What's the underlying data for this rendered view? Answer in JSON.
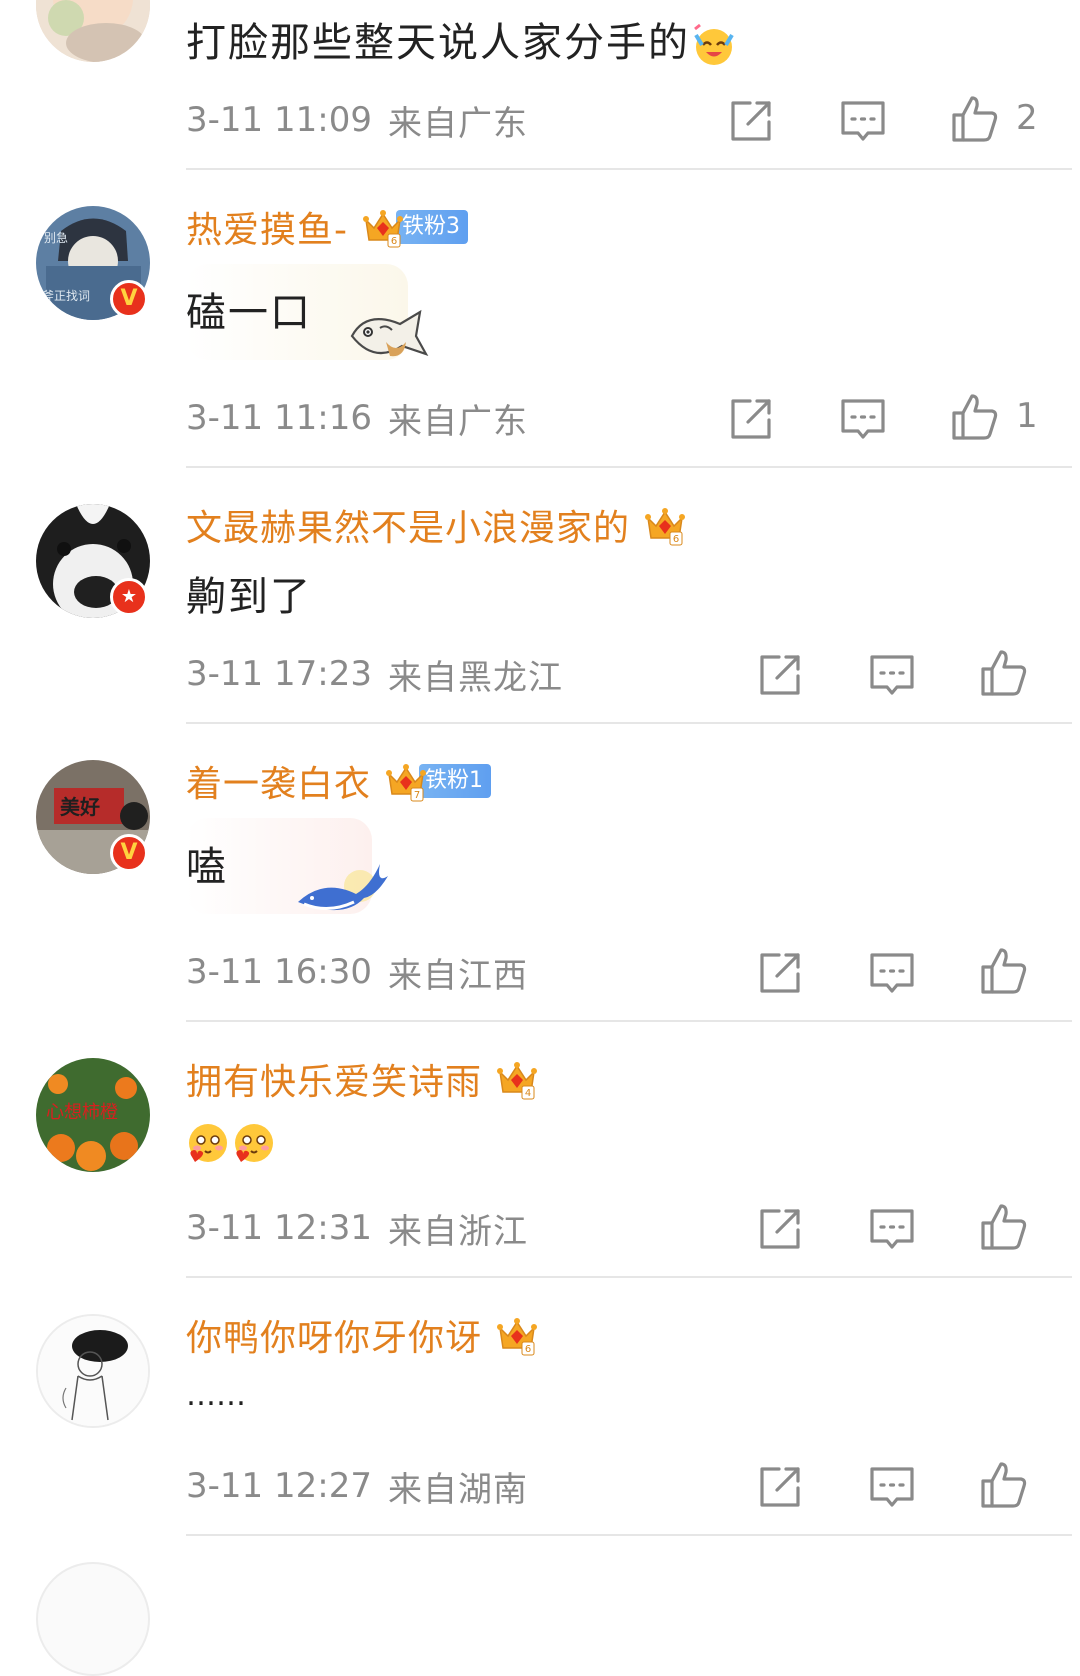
{
  "comments": [
    {
      "username": "",
      "text": "打脸那些整天说人家分手的",
      "time": "3-11 11:09",
      "location": "来自广东",
      "likes": "2",
      "avatar_icon": "baby-photo-avatar",
      "inline_emoji": "laugh-cry-emoji"
    },
    {
      "username": "热爱摸鱼-",
      "crown_level": "6",
      "fan_badge": "铁粉3",
      "text": "磕一口",
      "sticker": "fish-sticker",
      "time": "3-11 11:16",
      "location": "来自广东",
      "likes": "1",
      "avatar_icon": "cartoon-reading-avatar",
      "verified": true
    },
    {
      "username": "文晸赫果然不是小浪漫家的",
      "crown_level": "6",
      "text": "齁到了",
      "time": "3-11 17:23",
      "location": "来自黑龙江",
      "likes": "",
      "avatar_icon": "dog-avatar",
      "verified": true
    },
    {
      "username": "着一袭白衣",
      "crown_level": "7",
      "fan_badge": "铁粉1",
      "text": "嗑",
      "sticker": "whale-sticker",
      "time": "3-11 16:30",
      "location": "来自江西",
      "likes": "",
      "avatar_icon": "sign-photo-avatar",
      "verified": true
    },
    {
      "username": "拥有快乐爱笑诗雨",
      "crown_level": "4",
      "text": "",
      "emojis": [
        "heart-face-emoji",
        "heart-face-emoji"
      ],
      "time": "3-11 12:31",
      "location": "来自浙江",
      "likes": "",
      "avatar_icon": "oranges-avatar"
    },
    {
      "username": "你鸭你呀你牙你讶",
      "crown_level": "6",
      "text": "……",
      "time": "3-11 12:27",
      "location": "来自湖南",
      "likes": "",
      "avatar_icon": "sketch-girl-avatar"
    }
  ],
  "colors": {
    "username": "#e2801e",
    "meta": "#8a8a8a",
    "divider": "#e6e6e6",
    "fan_badge": "#5f9ff0",
    "verified_badge": "#e8311c"
  },
  "icons": {
    "share": "share-icon",
    "comment": "comment-icon",
    "like": "thumbs-up-icon",
    "crown": "crown-icon"
  }
}
